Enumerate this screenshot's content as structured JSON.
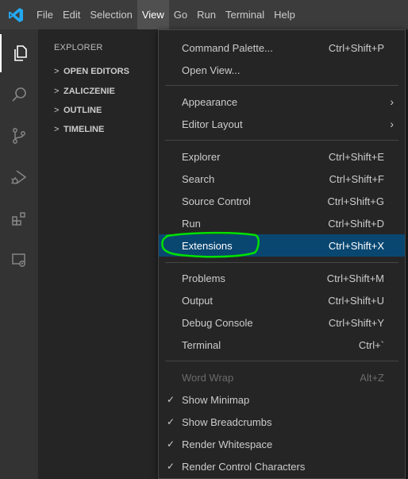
{
  "menubar": {
    "items": [
      "File",
      "Edit",
      "Selection",
      "View",
      "Go",
      "Run",
      "Terminal",
      "Help"
    ]
  },
  "activity": [
    "files-icon",
    "search-icon",
    "source-control-icon",
    "run-debug-icon",
    "extensions-icon",
    "remote-explorer-icon"
  ],
  "sidebar": {
    "title": "EXPLORER",
    "sections": [
      "OPEN EDITORS",
      "ZALICZENIE",
      "OUTLINE",
      "TIMELINE"
    ]
  },
  "view_menu": {
    "command_palette": {
      "label": "Command Palette...",
      "shortcut": "Ctrl+Shift+P"
    },
    "open_view": {
      "label": "Open View..."
    },
    "appearance": {
      "label": "Appearance"
    },
    "editor_layout": {
      "label": "Editor Layout"
    },
    "explorer": {
      "label": "Explorer",
      "shortcut": "Ctrl+Shift+E"
    },
    "search": {
      "label": "Search",
      "shortcut": "Ctrl+Shift+F"
    },
    "source_control": {
      "label": "Source Control",
      "shortcut": "Ctrl+Shift+G"
    },
    "run": {
      "label": "Run",
      "shortcut": "Ctrl+Shift+D"
    },
    "extensions": {
      "label": "Extensions",
      "shortcut": "Ctrl+Shift+X"
    },
    "problems": {
      "label": "Problems",
      "shortcut": "Ctrl+Shift+M"
    },
    "output": {
      "label": "Output",
      "shortcut": "Ctrl+Shift+U"
    },
    "debug_console": {
      "label": "Debug Console",
      "shortcut": "Ctrl+Shift+Y"
    },
    "terminal": {
      "label": "Terminal",
      "shortcut": "Ctrl+`"
    },
    "word_wrap": {
      "label": "Word Wrap",
      "shortcut": "Alt+Z"
    },
    "show_minimap": {
      "label": "Show Minimap",
      "check": "✓"
    },
    "show_breadcrumbs": {
      "label": "Show Breadcrumbs",
      "check": "✓"
    },
    "render_whitespace": {
      "label": "Render Whitespace",
      "check": "✓"
    },
    "render_control_chars": {
      "label": "Render Control Characters",
      "check": "✓"
    }
  },
  "colors": {
    "highlight": "#094771",
    "annotation_ring": "#00e000",
    "logo": "#23a9f2"
  }
}
